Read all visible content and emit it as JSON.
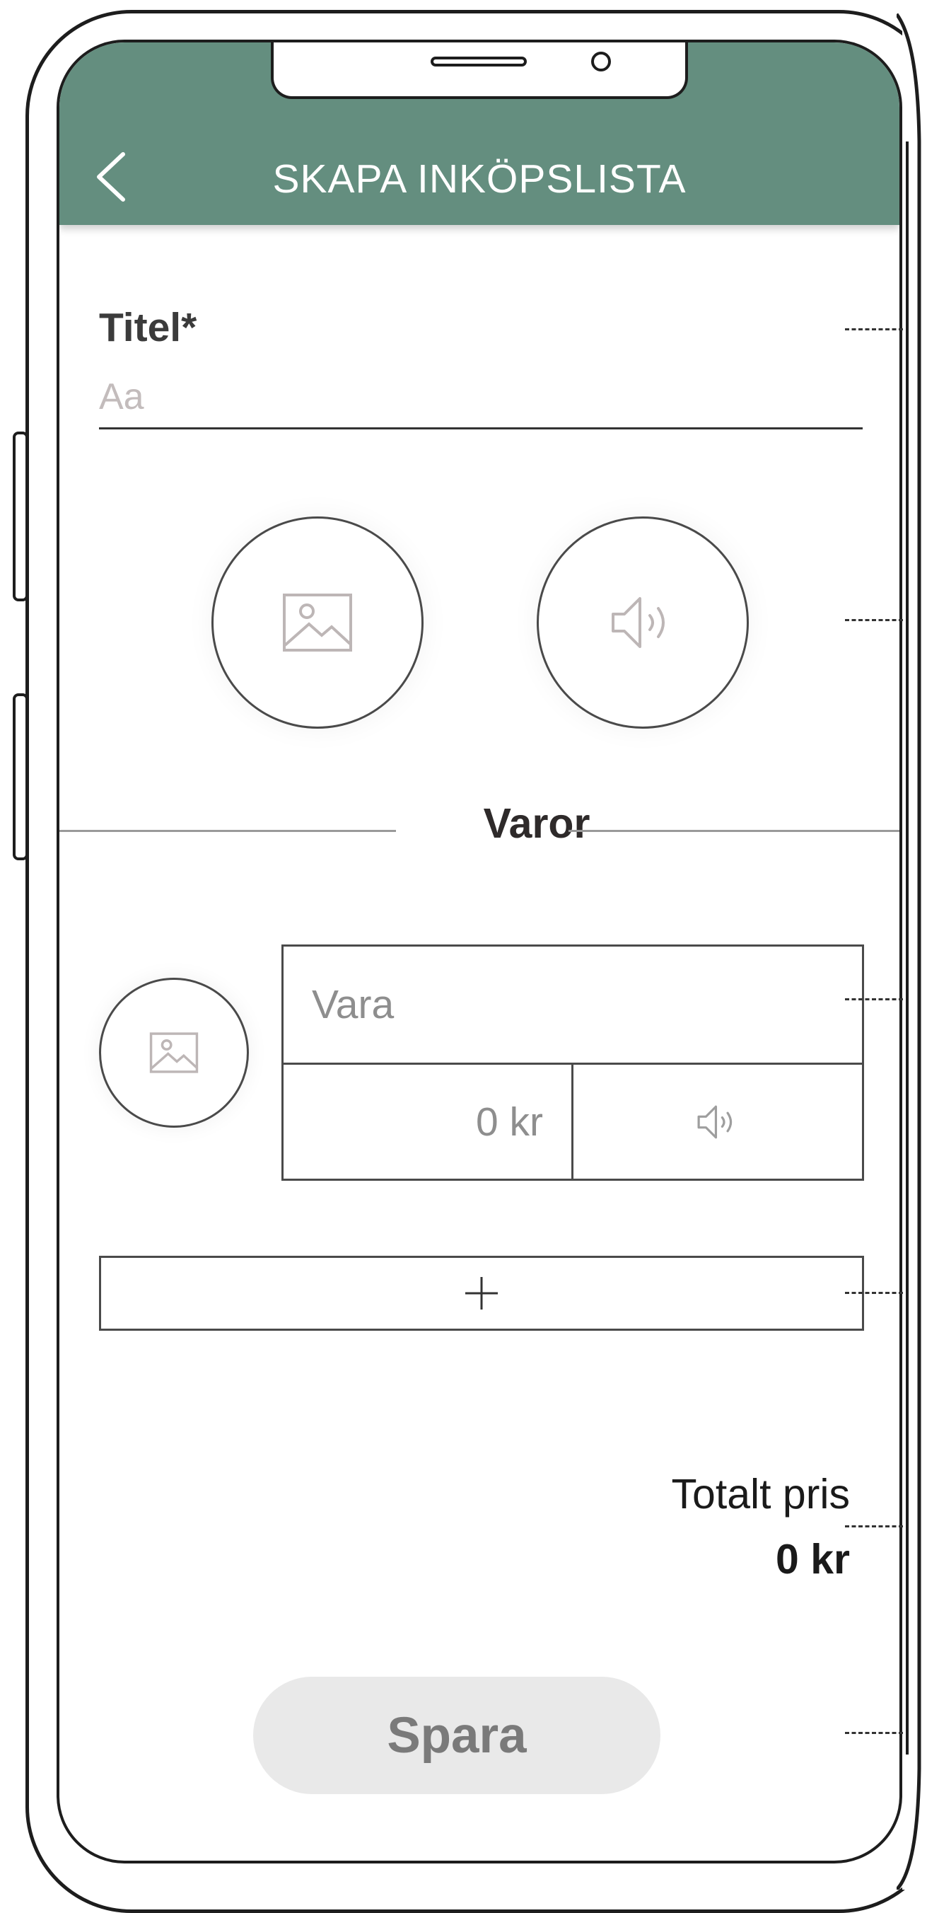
{
  "header": {
    "title": "SKAPA INKÖPSLISTA",
    "back_icon": "chevron-left-icon"
  },
  "form": {
    "title_label": "Titel*",
    "title_placeholder": "Aa",
    "image_icon": "image-icon",
    "audio_icon": "speaker-icon"
  },
  "items_section": {
    "heading": "Varor",
    "item": {
      "name_placeholder": "Vara",
      "price_placeholder": "0 kr"
    },
    "add_icon": "plus-icon"
  },
  "total": {
    "label": "Totalt pris",
    "value": "0 kr"
  },
  "save_button": {
    "label": "Spara"
  },
  "colors": {
    "header": "#648e7f",
    "button_bg": "#e9e9e9"
  }
}
